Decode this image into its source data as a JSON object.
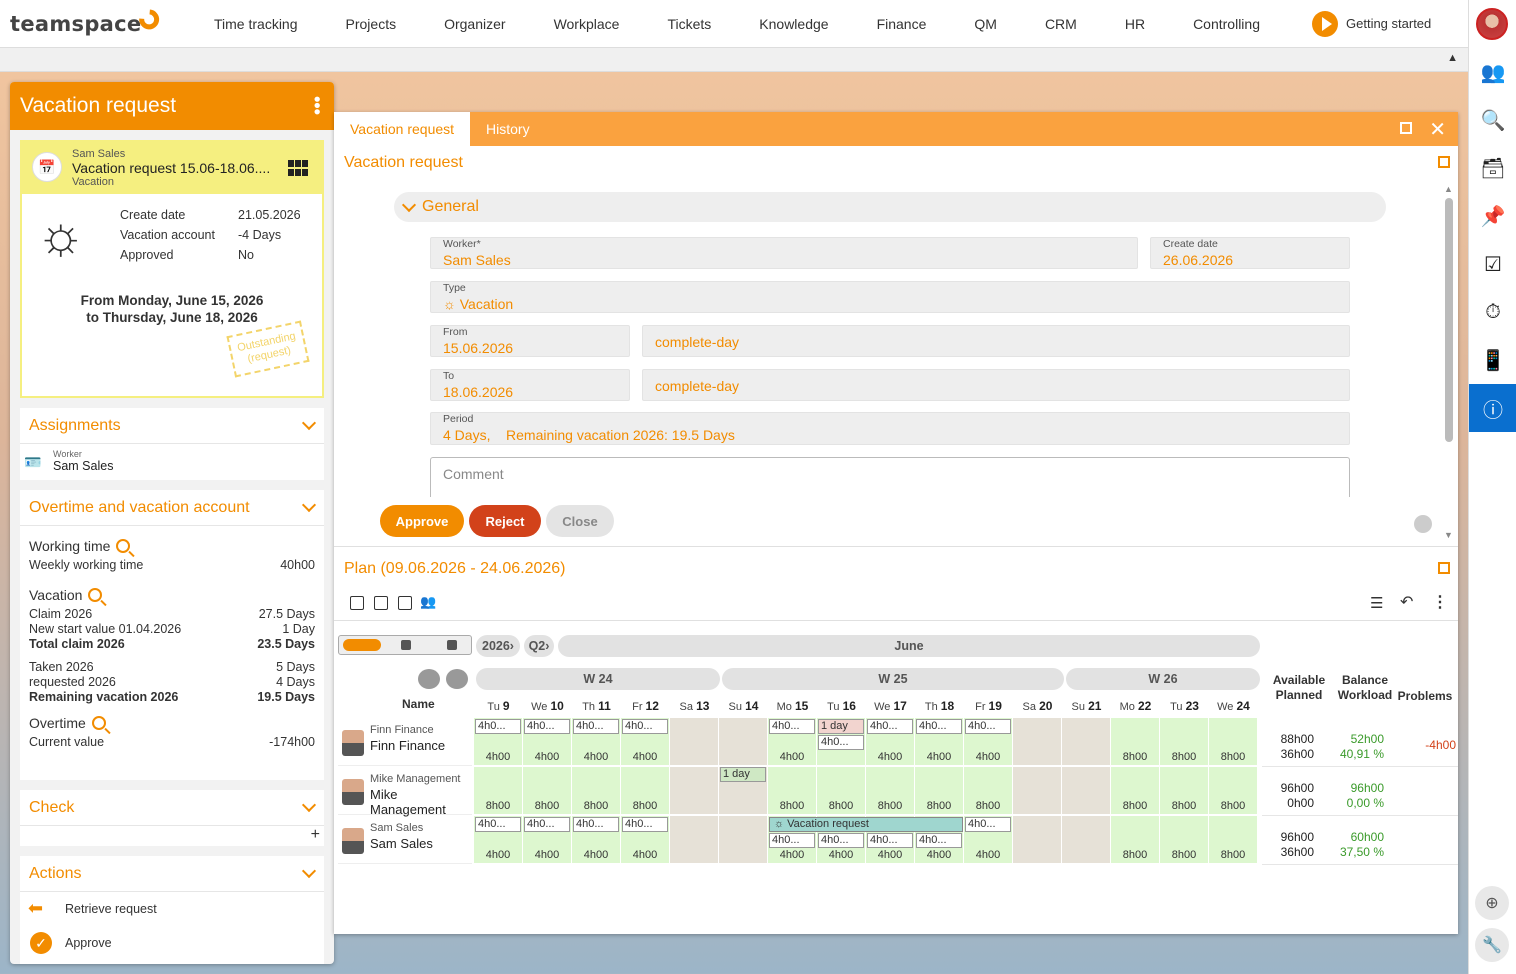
{
  "app": {
    "logo": "teamspace"
  },
  "nav": [
    "Time tracking",
    "Projects",
    "Organizer",
    "Workplace",
    "Tickets",
    "Knowledge",
    "Finance",
    "QM",
    "CRM",
    "HR",
    "Controlling"
  ],
  "getting_started": "Getting started",
  "left": {
    "title": "Vacation request",
    "card": {
      "person": "Sam Sales",
      "title": "Vacation request 15.06-18.06....",
      "type": "Vacation",
      "create_date_label": "Create date",
      "create_date": "21.05.2026",
      "account_label": "Vacation account",
      "account": "-4 Days",
      "approved_label": "Approved",
      "approved": "No",
      "from": "From Monday, June 15, 2026",
      "to": "to Thursday, June 18, 2026",
      "stamp1": "Outstanding",
      "stamp2": "(request)"
    },
    "assignments": {
      "title": "Assignments",
      "role": "Worker",
      "name": "Sam Sales"
    },
    "overtime": {
      "title": "Overtime and vacation account",
      "working_time": "Working time",
      "weekly_label": "Weekly working time",
      "weekly": "40h00",
      "vacation": "Vacation",
      "rows": [
        {
          "l": "Claim 2026",
          "v": "27.5 Days",
          "b": false
        },
        {
          "l": "New start value 01.04.2026",
          "v": "1 Day",
          "b": false
        },
        {
          "l": "Total claim 2026",
          "v": "23.5 Days",
          "b": true
        },
        {
          "l": "Taken 2026",
          "v": "5 Days",
          "b": false
        },
        {
          "l": "requested 2026",
          "v": "4 Days",
          "b": false
        },
        {
          "l": "Remaining vacation 2026",
          "v": "19.5 Days",
          "b": true
        }
      ],
      "overtime": "Overtime",
      "current_label": "Current value",
      "current": "-174h00"
    },
    "check": {
      "title": "Check",
      "plus": "+"
    },
    "actions": {
      "title": "Actions",
      "retrieve": "Retrieve request",
      "approve": "Approve"
    }
  },
  "dialog": {
    "tabs": [
      "Vacation request",
      "History"
    ],
    "title": "Vacation request",
    "general": "General",
    "worker_label": "Worker*",
    "worker": "Sam Sales",
    "create_label": "Create date",
    "create": "26.06.2026",
    "type_label": "Type",
    "type": "Vacation",
    "from_label": "From",
    "from": "15.06.2026",
    "from_mode": "complete-day",
    "to_label": "To",
    "to": "18.06.2026",
    "to_mode": "complete-day",
    "period_label": "Period",
    "period": "4 Days,",
    "remaining": "Remaining vacation 2026: 19.5 Days",
    "comment_placeholder": "Comment",
    "approve": "Approve",
    "reject": "Reject",
    "close": "Close"
  },
  "plan": {
    "title": "Plan (09.06.2026 - 24.06.2026)",
    "year": "2026›",
    "quarter": "Q2›",
    "month": "June",
    "weeks": [
      "W 24",
      "W 25",
      "W 26"
    ],
    "name_header": "Name",
    "stat_headers": [
      {
        "a": "Available",
        "b": "Planned"
      },
      {
        "a": "Balance",
        "b": "Workload"
      },
      {
        "a": "Problems",
        "b": ""
      }
    ],
    "days": [
      {
        "d": "Tu",
        "n": "9",
        "we": false
      },
      {
        "d": "We",
        "n": "10",
        "we": false
      },
      {
        "d": "Th",
        "n": "11",
        "we": false
      },
      {
        "d": "Fr",
        "n": "12",
        "we": false
      },
      {
        "d": "Sa",
        "n": "13",
        "we": true
      },
      {
        "d": "Su",
        "n": "14",
        "we": true
      },
      {
        "d": "Mo",
        "n": "15",
        "we": false
      },
      {
        "d": "Tu",
        "n": "16",
        "we": false
      },
      {
        "d": "We",
        "n": "17",
        "we": false
      },
      {
        "d": "Th",
        "n": "18",
        "we": false
      },
      {
        "d": "Fr",
        "n": "19",
        "we": false
      },
      {
        "d": "Sa",
        "n": "20",
        "we": true
      },
      {
        "d": "Su",
        "n": "21",
        "we": true
      },
      {
        "d": "Mo",
        "n": "22",
        "we": false
      },
      {
        "d": "Tu",
        "n": "23",
        "we": false
      },
      {
        "d": "We",
        "n": "24",
        "we": false
      }
    ],
    "rows": [
      {
        "short": "Finn Finance",
        "full": "Finn Finance",
        "avail": "88h00",
        "planned": "36h00",
        "balance": "52h00",
        "workload": "40,91 %",
        "problem": "-4h00",
        "cells": [
          "4h00",
          "4h00",
          "4h00",
          "4h00",
          "",
          "",
          "4h00",
          "",
          "4h00",
          "4h00",
          "4h00",
          "",
          "",
          "8h00",
          "8h00",
          "8h00"
        ],
        "chips": [
          "4h0...",
          "4h0...",
          "4h0...",
          "4h0...",
          "",
          "",
          "4h0...",
          "1 day",
          "4h0...",
          "4h0...",
          "4h0...",
          "",
          "",
          "",
          "",
          ""
        ],
        "chips2": [
          "",
          "",
          "",
          "",
          "",
          "",
          "",
          "4h0...",
          "",
          "",
          "",
          "",
          "",
          "",
          "",
          ""
        ]
      },
      {
        "short": "Mike Management",
        "full": "Mike Management",
        "avail": "96h00",
        "planned": "0h00",
        "balance": "96h00",
        "workload": "0,00 %",
        "problem": "",
        "cells": [
          "8h00",
          "8h00",
          "8h00",
          "8h00",
          "",
          "",
          "8h00",
          "8h00",
          "8h00",
          "8h00",
          "8h00",
          "",
          "",
          "8h00",
          "8h00",
          "8h00"
        ],
        "chips": [
          "",
          "",
          "",
          "",
          "",
          "1 day",
          "",
          "",
          "",
          "",
          "",
          "",
          "",
          "",
          "",
          ""
        ],
        "chips2": [
          "",
          "",
          "",
          "",
          "",
          "",
          "",
          "",
          "",
          "",
          "",
          "",
          "",
          "",
          "",
          ""
        ]
      },
      {
        "short": "Sam Sales",
        "full": "Sam Sales",
        "avail": "96h00",
        "planned": "36h00",
        "balance": "60h00",
        "workload": "37,50 %",
        "problem": "",
        "cells": [
          "4h00",
          "4h00",
          "4h00",
          "4h00",
          "",
          "",
          "4h00",
          "4h00",
          "4h00",
          "4h00",
          "4h00",
          "",
          "",
          "8h00",
          "8h00",
          "8h00"
        ],
        "chips": [
          "4h0...",
          "4h0...",
          "4h0...",
          "4h0...",
          "",
          "",
          "",
          "",
          "",
          "",
          "4h0...",
          "",
          "",
          "",
          "",
          ""
        ],
        "chips2": [
          "",
          "",
          "",
          "",
          "",
          "",
          "4h0...",
          "4h0...",
          "4h0...",
          "4h0...",
          "",
          "",
          "",
          "",
          "",
          ""
        ],
        "bar": "Vacation request"
      }
    ]
  }
}
